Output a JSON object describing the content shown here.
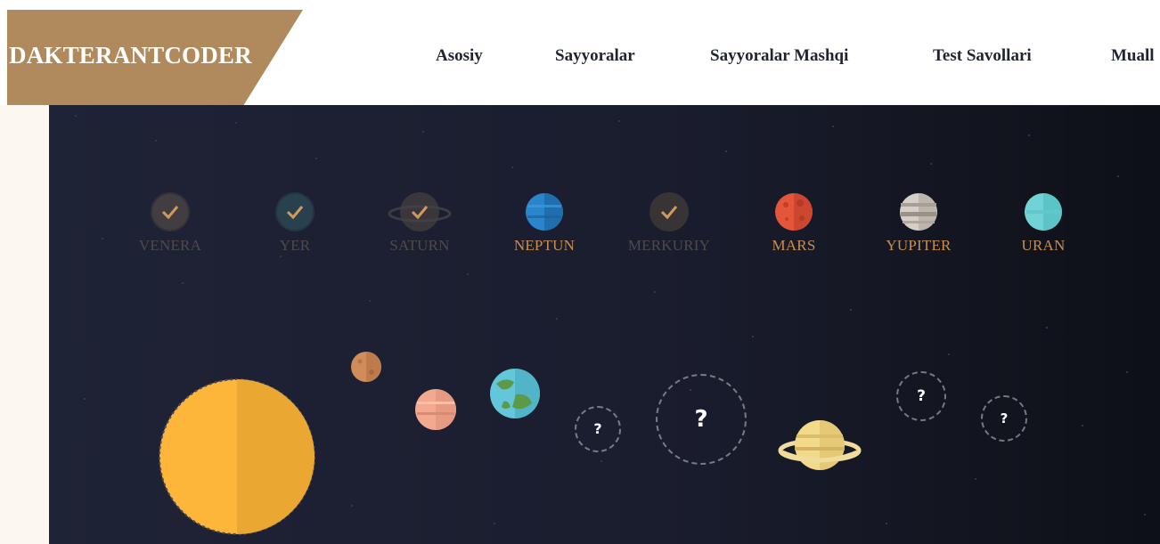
{
  "header": {
    "logo": "DAKTERANTCODER",
    "nav": [
      "Asosiy",
      "Sayyoralar",
      "Sayyoralar Mashqi",
      "Test Savollari",
      "Muall"
    ]
  },
  "selector": {
    "planets": [
      {
        "name": "VENERA",
        "state": "done"
      },
      {
        "name": "YER",
        "state": "done"
      },
      {
        "name": "SATURN",
        "state": "done"
      },
      {
        "name": "NEPTUN",
        "state": "todo"
      },
      {
        "name": "MERKURIY",
        "state": "done"
      },
      {
        "name": "MARS",
        "state": "todo"
      },
      {
        "name": "YUPITER",
        "state": "todo"
      },
      {
        "name": "URAN",
        "state": "todo"
      }
    ]
  },
  "slots": {
    "unknown_mark": "?"
  },
  "colors": {
    "logo_bg": "#b08a5c",
    "label_active": "#c98e4f",
    "label_done": "#4e4a4a",
    "sun": "#fdb53a",
    "space": "#1f2336"
  }
}
